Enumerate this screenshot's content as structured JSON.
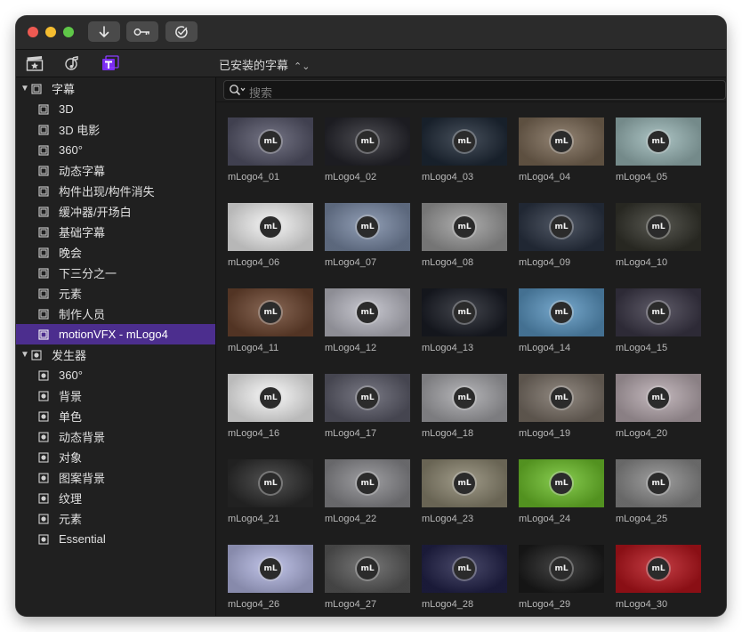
{
  "toolbar": {
    "buttons": [
      {
        "name": "import-button",
        "icon": "download-arrow-icon"
      },
      {
        "name": "keywords-button",
        "icon": "key-icon"
      },
      {
        "name": "background-tasks-button",
        "icon": "checkmark-circle-icon"
      }
    ]
  },
  "library": {
    "tabs": [
      {
        "name": "photos-videos-tab",
        "icon": "clapper-star-icon"
      },
      {
        "name": "music-sound-tab",
        "icon": "music-note-icon"
      },
      {
        "name": "titles-generators-tab",
        "icon": "titles-t-icon",
        "active": true
      }
    ],
    "dropdown_label": "已安装的字幕",
    "dropdown_icon": "updown-chevron-icon"
  },
  "sidebar": {
    "groups": [
      {
        "label": "字幕",
        "expanded": true,
        "icon": "film-frame-icon",
        "items": [
          "3D",
          "3D 电影",
          "360°",
          "动态字幕",
          "构件出现/构件消失",
          "缓冲器/开场白",
          "基础字幕",
          "晚会",
          "下三分之一",
          "元素",
          "制作人员",
          "motionVFX - mLogo4"
        ],
        "selected_index": 11
      },
      {
        "label": "发生器",
        "expanded": true,
        "icon": "generator-icon",
        "items": [
          "360°",
          "背景",
          "单色",
          "动态背景",
          "对象",
          "图案背景",
          "纹理",
          "元素",
          "Essential"
        ]
      }
    ]
  },
  "search": {
    "placeholder": "搜索",
    "icon": "search-icon"
  },
  "grid": {
    "logo_text": "mL",
    "items": [
      {
        "label": "mLogo4_01",
        "bg": "#56566a"
      },
      {
        "label": "mLogo4_02",
        "bg": "#25252c"
      },
      {
        "label": "mLogo4_03",
        "bg": "#1f2a38"
      },
      {
        "label": "mLogo4_04",
        "bg": "#7c6a56"
      },
      {
        "label": "mLogo4_05",
        "bg": "#9bb8b8"
      },
      {
        "label": "mLogo4_06",
        "bg": "#f4f4f4"
      },
      {
        "label": "mLogo4_07",
        "bg": "#7a8aa6"
      },
      {
        "label": "mLogo4_08",
        "bg": "#9c9c9c"
      },
      {
        "label": "mLogo4_09",
        "bg": "#2b3444"
      },
      {
        "label": "mLogo4_10",
        "bg": "#34342c"
      },
      {
        "label": "mLogo4_11",
        "bg": "#6e4630"
      },
      {
        "label": "mLogo4_12",
        "bg": "#bcbcc6"
      },
      {
        "label": "mLogo4_13",
        "bg": "#1a1d26"
      },
      {
        "label": "mLogo4_14",
        "bg": "#5a96c2"
      },
      {
        "label": "mLogo4_15",
        "bg": "#3c3848"
      },
      {
        "label": "mLogo4_16",
        "bg": "#f8f8f8"
      },
      {
        "label": "mLogo4_17",
        "bg": "#5c5c6a"
      },
      {
        "label": "mLogo4_18",
        "bg": "#a6a6aa"
      },
      {
        "label": "mLogo4_19",
        "bg": "#7a7066"
      },
      {
        "label": "mLogo4_20",
        "bg": "#b8aab0"
      },
      {
        "label": "mLogo4_21",
        "bg": "#2c2c2c"
      },
      {
        "label": "mLogo4_22",
        "bg": "#8a8a8e"
      },
      {
        "label": "mLogo4_23",
        "bg": "#8c8670"
      },
      {
        "label": "mLogo4_24",
        "bg": "#6ec22a"
      },
      {
        "label": "mLogo4_25",
        "bg": "#8a8a8a"
      },
      {
        "label": "mLogo4_26",
        "bg": "#b4b8e4"
      },
      {
        "label": "mLogo4_27",
        "bg": "#5a5a5a"
      },
      {
        "label": "mLogo4_28",
        "bg": "#22224a"
      },
      {
        "label": "mLogo4_29",
        "bg": "#1c1c1c"
      },
      {
        "label": "mLogo4_30",
        "bg": "#b8141c"
      }
    ]
  },
  "colors": {
    "selection": "#4c2e8e",
    "accent_purple": "#8a3cff",
    "window_bg": "#1e1e1e"
  }
}
